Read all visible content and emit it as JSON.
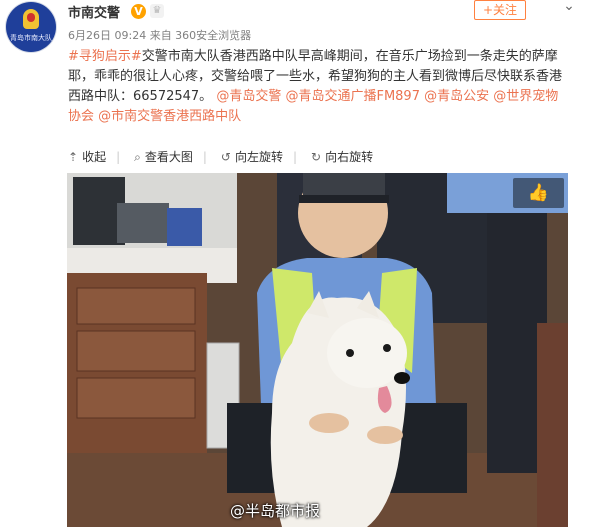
{
  "account": {
    "avatar_text": "青岛市南大队",
    "name": "市南交警",
    "verified_badge": "V",
    "crown_badge": "♛",
    "follow_label": "+关注",
    "more_label": "⌄"
  },
  "post": {
    "meta": "6月26日 09:24 来自 360安全浏览器",
    "topic": "#寻狗启示#",
    "body": "交警市南大队香港西路中队早高峰期间，在音乐广场捡到一条走失的萨摩耶，乖乖的很让人心疼，交警给喂了一些水，希望狗狗的主人看到微博后尽快联系香港西路中队：66572547。",
    "mentions": [
      "@青岛交警",
      "@青岛交通广播FM897",
      "@青岛公安",
      "@世界宠物协会",
      "@市南交警香港西路中队"
    ]
  },
  "toolbar": {
    "collapse": "收起",
    "view_large": "查看大图",
    "rotate_left": "向左旋转",
    "rotate_right": "向右旋转"
  },
  "image": {
    "like_icon": "like-icon",
    "watermark": "@半岛都市报",
    "description_colors": {
      "uniform": "#6f97d6",
      "vest": "#cfe86a",
      "dog": "#f3f0ea"
    }
  },
  "colors": {
    "accent": "#eb7350",
    "follow": "#ff8140",
    "avatar": "#1f3f9a"
  }
}
